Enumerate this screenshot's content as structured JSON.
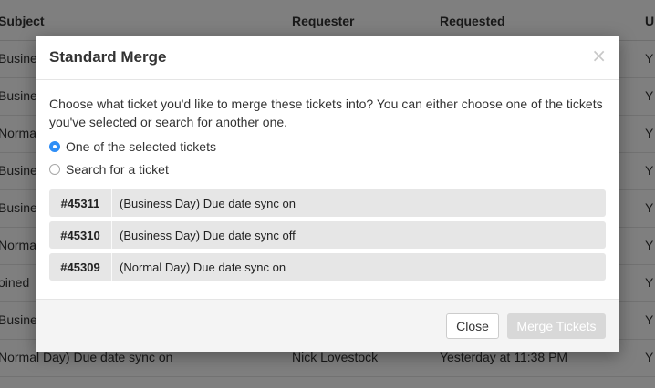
{
  "table": {
    "headers": {
      "subject": "Subject",
      "requester": "Requester",
      "requested": "Requested"
    },
    "rows": [
      {
        "subject": "Busine",
        "requester": "",
        "time": "",
        "u": "Y"
      },
      {
        "subject": "Busine",
        "requester": "",
        "time": "",
        "u": "Y"
      },
      {
        "subject": "Norma",
        "requester": "",
        "time": "",
        "u": "Y"
      },
      {
        "subject": "Busine",
        "requester": "",
        "time": "",
        "u": "Y"
      },
      {
        "subject": "Busine",
        "requester": "",
        "time": "",
        "u": "Y"
      },
      {
        "subject": "Norma",
        "requester": "",
        "time": "",
        "u": "Y"
      },
      {
        "subject": "oined",
        "requester": "",
        "time": "",
        "u": "Y"
      },
      {
        "subject": "Busine",
        "requester": "",
        "time": "",
        "u": "Y"
      },
      {
        "subject": "Normal Day) Due date sync on",
        "requester": "Nick Lovestock",
        "time": "Yesterday at 11:38 PM",
        "u": "Y"
      }
    ]
  },
  "modal": {
    "title": "Standard Merge",
    "close_glyph": "×",
    "description": "Choose what ticket you'd like to merge these tickets into? You can either choose one of the tickets you've selected or search for another one.",
    "options": [
      {
        "label": "One of the selected tickets",
        "selected": true
      },
      {
        "label": "Search for a ticket",
        "selected": false
      }
    ],
    "tickets": [
      {
        "id": "#45311",
        "subject": "(Business Day) Due date sync on"
      },
      {
        "id": "#45310",
        "subject": "(Business Day) Due date sync off"
      },
      {
        "id": "#45309",
        "subject": "(Normal Day) Due date sync on"
      }
    ],
    "close_button": "Close",
    "merge_button": "Merge Tickets"
  },
  "colors": {
    "accent": "#2f8ef6",
    "disabled": "#d8d8d8"
  },
  "icons": {
    "close": "close-icon"
  }
}
